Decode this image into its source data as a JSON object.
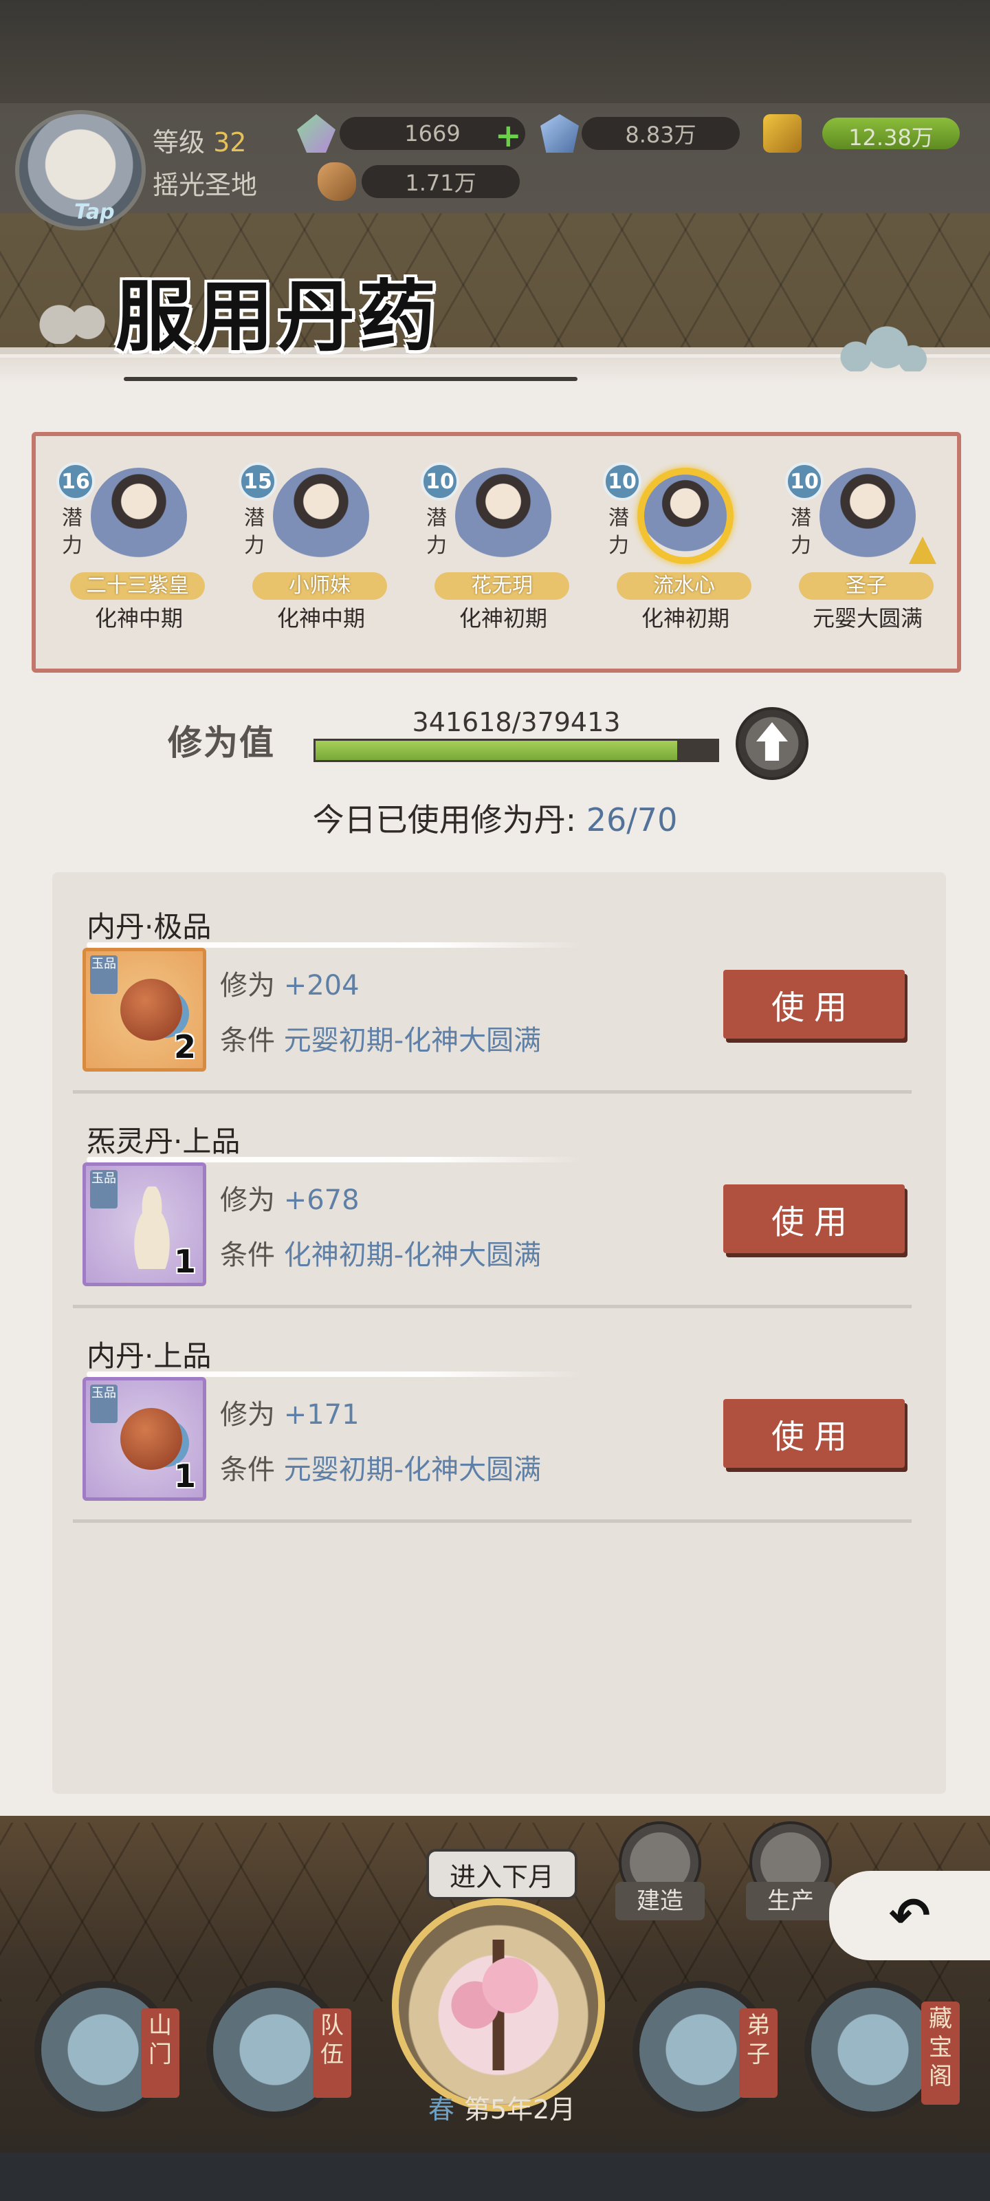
{
  "header": {
    "level_label": "等级",
    "level_value": "32",
    "sect_name": "摇光圣地",
    "avatar_tap": "Tap",
    "resources": {
      "gems": "1669",
      "crystals": "8.83万",
      "gold": "12.38万",
      "wood": "1.71万"
    }
  },
  "dialog": {
    "title": "服用丹药",
    "disciples": [
      {
        "potential": "16",
        "potential_label": "潜力",
        "name": "二十三紫皇",
        "stage": "化神中期"
      },
      {
        "potential": "15",
        "potential_label": "潜力",
        "name": "小师妹",
        "stage": "化神中期"
      },
      {
        "potential": "10",
        "potential_label": "潜力",
        "name": "花无玥",
        "stage": "化神初期"
      },
      {
        "potential": "10",
        "potential_label": "潜力",
        "name": "流水心",
        "stage": "化神初期"
      },
      {
        "potential": "10",
        "potential_label": "潜力",
        "name": "圣子",
        "stage": "元婴大圆满"
      }
    ],
    "cultivation": {
      "label": "修为值",
      "value_text": "341618/379413",
      "progress": 0.9004
    },
    "today": {
      "label": "今日已使用修为丹:",
      "value": "26/70"
    },
    "pills": [
      {
        "title": "内丹·极品",
        "count": "2",
        "stat_label": "修为",
        "stat_value": "+204",
        "cond_label": "条件",
        "cond_value": "元婴初期-化神大圆满",
        "button": "使用",
        "grade": "玉品"
      },
      {
        "title": "炁灵丹·上品",
        "count": "1",
        "stat_label": "修为",
        "stat_value": "+678",
        "cond_label": "条件",
        "cond_value": "化神初期-化神大圆满",
        "button": "使用",
        "grade": "玉品"
      },
      {
        "title": "内丹·上品",
        "count": "1",
        "stat_label": "修为",
        "stat_value": "+171",
        "cond_label": "条件",
        "cond_value": "元婴初期-化神大圆满",
        "button": "使用",
        "grade": "玉品"
      }
    ]
  },
  "bottom": {
    "next_month": "进入下月",
    "build": "建造",
    "produce": "生产",
    "back_icon": "back-arrow-icon",
    "nav": [
      {
        "label": "山门"
      },
      {
        "label": "队伍"
      },
      {
        "label": "弟子"
      },
      {
        "label": "藏宝阁"
      }
    ],
    "season": "春",
    "date": "第5年2月"
  },
  "colors": {
    "accent_red": "#b0513f",
    "value_blue": "#5f80a6",
    "progress_green": "#8bbd3a",
    "frame_red": "#c3776a"
  }
}
